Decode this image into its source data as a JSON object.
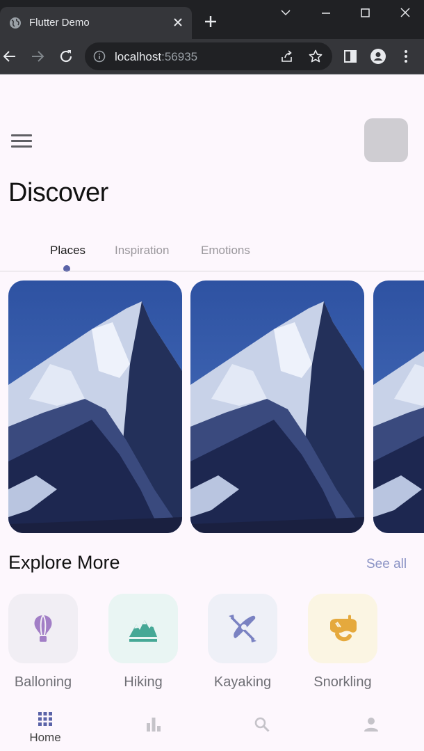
{
  "browser": {
    "tab_title": "Flutter Demo",
    "url_host": "localhost",
    "url_port": ":56935"
  },
  "header": {
    "title": "Discover"
  },
  "tabs": [
    {
      "label": "Places",
      "active": true
    },
    {
      "label": "Inspiration",
      "active": false
    },
    {
      "label": "Emotions",
      "active": false
    }
  ],
  "cards": [
    {
      "image": "mountain-photo"
    },
    {
      "image": "mountain-photo"
    },
    {
      "image": "mountain-photo"
    }
  ],
  "explore": {
    "title": "Explore More",
    "see_all": "See all",
    "items": [
      {
        "label": "Balloning",
        "icon": "hot-air-balloon-icon",
        "color": "#a27ec6",
        "bg": "#f1eef4"
      },
      {
        "label": "Hiking",
        "icon": "mountains-icon",
        "color": "#46a896",
        "bg": "#e9f5f3"
      },
      {
        "label": "Kayaking",
        "icon": "kayak-icon",
        "color": "#7a82c2",
        "bg": "#eef0f7"
      },
      {
        "label": "Snorkling",
        "icon": "snorkel-mask-icon",
        "color": "#e5a93d",
        "bg": "#fbf5e3"
      }
    ]
  },
  "bottom_nav": [
    {
      "label": "Home",
      "icon": "grid-icon",
      "active": true
    },
    {
      "label": "",
      "icon": "bar-chart-icon",
      "active": false
    },
    {
      "label": "",
      "icon": "search-icon",
      "active": false
    },
    {
      "label": "",
      "icon": "person-icon",
      "active": false
    }
  ],
  "colors": {
    "background": "#fdf7fd",
    "accent": "#5a63a8",
    "see_all": "#8a92c4"
  }
}
